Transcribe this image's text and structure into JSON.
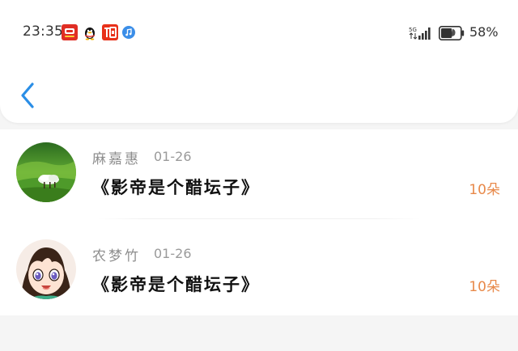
{
  "status_bar": {
    "time": "23:35",
    "network": "5G",
    "battery_percent": "58%",
    "battery_level": 0.58,
    "notification_icons": [
      "pinduoduo-icon",
      "qq-icon",
      "taobao-icon",
      "music-icon"
    ]
  },
  "header": {
    "back_icon": "chevron-left-icon"
  },
  "colors": {
    "accent_blue": "#2a8ee6",
    "count_orange": "#e8894a",
    "name_gray": "#8e8e8e"
  },
  "gifts": [
    {
      "name": "麻嘉惠",
      "date": "01-26",
      "title": "《影帝是个醋坛子》",
      "count": "10朵",
      "avatar": "green-landscape-avatar"
    },
    {
      "name": "农梦竹",
      "date": "01-26",
      "title": "《影帝是个醋坛子》",
      "count": "10朵",
      "avatar": "anime-girl-avatar"
    }
  ]
}
